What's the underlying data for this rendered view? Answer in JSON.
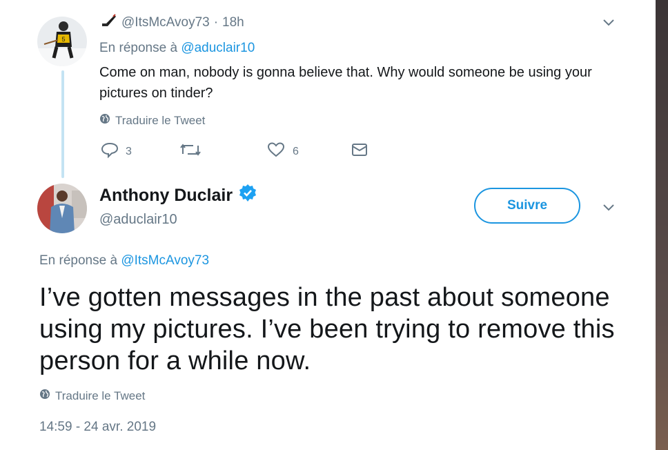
{
  "reply_tweet": {
    "handle": "@ItsMcAvoy73",
    "separator": "·",
    "time": "18h",
    "reply_prefix": "En réponse à",
    "reply_to": "@aduclair10",
    "text": "Come on man, nobody is gonna believe that. Why would someone be using your pictures on tinder?",
    "translate": "Traduire le Tweet",
    "reply_count": "3",
    "like_count": "6"
  },
  "main_tweet": {
    "name": "Anthony Duclair",
    "handle": "@aduclair10",
    "follow_label": "Suivre",
    "reply_prefix": "En réponse à",
    "reply_to": "@ItsMcAvoy73",
    "text": "I’ve gotten messages in the past about someone using my pictures. I’ve been trying to remove this person for a while now.",
    "translate": "Traduire le Tweet",
    "timestamp": "14:59 - 24 avr. 2019"
  },
  "colors": {
    "link": "#1b95e0",
    "muted": "#657786",
    "verified": "#1da1f2",
    "thread_line": "#c4e3f3"
  },
  "icons": [
    "hockey-stick-icon",
    "globe-icon",
    "reply-icon",
    "retweet-icon",
    "heart-icon",
    "mail-icon",
    "chevron-down-icon",
    "verified-badge-icon"
  ]
}
